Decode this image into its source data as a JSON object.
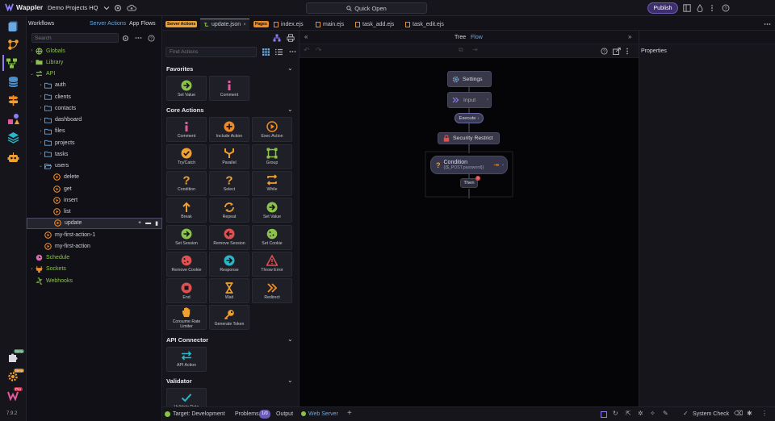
{
  "app": {
    "name": "Wappler",
    "version": "7.9.2"
  },
  "topbar": {
    "project": "Demo Projects HQ",
    "quick_open": "Quick Open",
    "publish": "Publish"
  },
  "workflows": {
    "title": "Workflows",
    "tabs": [
      "Server Actions",
      "App Flows"
    ],
    "search_placeholder": "Search",
    "tree": [
      {
        "label": "Globals",
        "level": 0,
        "icon": "globe-icon",
        "color": "#8bc34a"
      },
      {
        "label": "Library",
        "level": 0,
        "icon": "library-folder-icon",
        "color": "#8bc34a"
      },
      {
        "label": "API",
        "level": 0,
        "icon": "api-icon",
        "color": "#8bc34a"
      },
      {
        "label": "auth",
        "level": 1,
        "icon": "folder-icon"
      },
      {
        "label": "clients",
        "level": 1,
        "icon": "folder-icon"
      },
      {
        "label": "contacts",
        "level": 1,
        "icon": "folder-icon"
      },
      {
        "label": "dashboard",
        "level": 1,
        "icon": "folder-icon"
      },
      {
        "label": "files",
        "level": 1,
        "icon": "folder-icon"
      },
      {
        "label": "projects",
        "level": 1,
        "icon": "folder-icon"
      },
      {
        "label": "tasks",
        "level": 1,
        "icon": "folder-icon"
      },
      {
        "label": "users",
        "level": 1,
        "icon": "folder-open-icon"
      },
      {
        "label": "delete",
        "level": 2,
        "icon": "action-icon"
      },
      {
        "label": "get",
        "level": 2,
        "icon": "action-icon"
      },
      {
        "label": "insert",
        "level": 2,
        "icon": "action-icon"
      },
      {
        "label": "list",
        "level": 2,
        "icon": "action-icon"
      },
      {
        "label": "update",
        "level": 2,
        "icon": "action-icon",
        "selected": true
      },
      {
        "label": "my-first-action-1",
        "level": 1,
        "icon": "action-icon"
      },
      {
        "label": "my-first-action",
        "level": 1,
        "icon": "action-icon"
      },
      {
        "label": "Schedule",
        "level": 0,
        "icon": "clock-icon",
        "color": "#8bc34a"
      },
      {
        "label": "Sockets",
        "level": 0,
        "icon": "socket-icon",
        "color": "#8bc34a"
      },
      {
        "label": "Webhooks",
        "level": 0,
        "icon": "webhook-icon",
        "color": "#8bc34a"
      }
    ]
  },
  "tabs": [
    {
      "chip": "Server Actions",
      "label": "update.json",
      "active": true
    },
    {
      "chip": "Pages",
      "label": "index.ejs"
    },
    {
      "label": "main.ejs"
    },
    {
      "label": "task_add.ejs"
    },
    {
      "label": "task_edit.ejs"
    }
  ],
  "actions": {
    "search_placeholder": "Find Actions",
    "groups": [
      {
        "title": "Favorites",
        "items": [
          {
            "label": "Set Value",
            "icon": "arrow-right-circle-icon",
            "color": "#8bc34a"
          },
          {
            "label": "Comment",
            "icon": "info-icon",
            "color": "#e05a9c"
          }
        ]
      },
      {
        "title": "Core Actions",
        "items": [
          {
            "label": "Comment",
            "icon": "info-icon",
            "color": "#e05a9c"
          },
          {
            "label": "Include Action",
            "icon": "plus-circle-icon",
            "color": "#f08a24"
          },
          {
            "label": "Exec Action",
            "icon": "play-circle-icon",
            "color": "#f08a24"
          },
          {
            "label": "Try/Catch",
            "icon": "check-circle-icon",
            "color": "#f0a030"
          },
          {
            "label": "Parallel",
            "icon": "parallel-icon",
            "color": "#f0a030"
          },
          {
            "label": "Group",
            "icon": "group-icon",
            "color": "#8bc34a"
          },
          {
            "label": "Condition",
            "icon": "question-icon",
            "color": "#f0a030"
          },
          {
            "label": "Select",
            "icon": "question-icon",
            "color": "#f0a030"
          },
          {
            "label": "While",
            "icon": "loop-icon",
            "color": "#f0a030"
          },
          {
            "label": "Break",
            "icon": "break-icon",
            "color": "#f0a030"
          },
          {
            "label": "Repeat",
            "icon": "repeat-icon",
            "color": "#f0a030"
          },
          {
            "label": "Set Value",
            "icon": "arrow-right-circle-icon",
            "color": "#8bc34a"
          },
          {
            "label": "Set Session",
            "icon": "arrow-right-circle-icon",
            "color": "#8bc34a"
          },
          {
            "label": "Remove Session",
            "icon": "arrow-left-circle-icon",
            "color": "#e05050"
          },
          {
            "label": "Set Cookie",
            "icon": "cookie-icon",
            "color": "#8bc34a"
          },
          {
            "label": "Remove Cookie",
            "icon": "cookie-icon",
            "color": "#e05050"
          },
          {
            "label": "Response",
            "icon": "arrow-right-circle-icon",
            "color": "#29b6c8"
          },
          {
            "label": "Throw Error",
            "icon": "warning-icon",
            "color": "#e05050"
          },
          {
            "label": "End",
            "icon": "stop-icon",
            "color": "#e05050"
          },
          {
            "label": "Wait",
            "icon": "hourglass-icon",
            "color": "#f0a030"
          },
          {
            "label": "Redirect",
            "icon": "redirect-icon",
            "color": "#f08a24"
          },
          {
            "label": "Consume Rate Limiter",
            "icon": "hand-icon",
            "color": "#f0a030"
          },
          {
            "label": "Generate Token",
            "icon": "key-icon",
            "color": "#f0a030"
          }
        ]
      },
      {
        "title": "API Connector",
        "items": [
          {
            "label": "API Action",
            "icon": "swap-icon",
            "color": "#29b6c8"
          }
        ]
      },
      {
        "title": "Validator",
        "items": [
          {
            "label": "Validate Data",
            "icon": "checkmark-icon",
            "color": "#29b6c8"
          }
        ]
      }
    ]
  },
  "canvas": {
    "view_tabs": [
      "Tree",
      "Flow"
    ],
    "active_view": "Flow",
    "nodes": {
      "settings": "Settings",
      "input": "Input",
      "execute": "Execute",
      "security": "Security Restrict",
      "condition_title": "Condition",
      "condition_expr": "{{$_POST.password}}",
      "then": "Then"
    }
  },
  "properties": {
    "title": "Properties"
  },
  "status": {
    "target_label": "Target: Development",
    "problems_label": "Problems",
    "problems_count": "1/0",
    "output_label": "Output",
    "server_label": "Web Server",
    "system_check": "System Check"
  },
  "rail": {
    "badges": [
      "Beta",
      "Beta",
      "Pro"
    ]
  }
}
